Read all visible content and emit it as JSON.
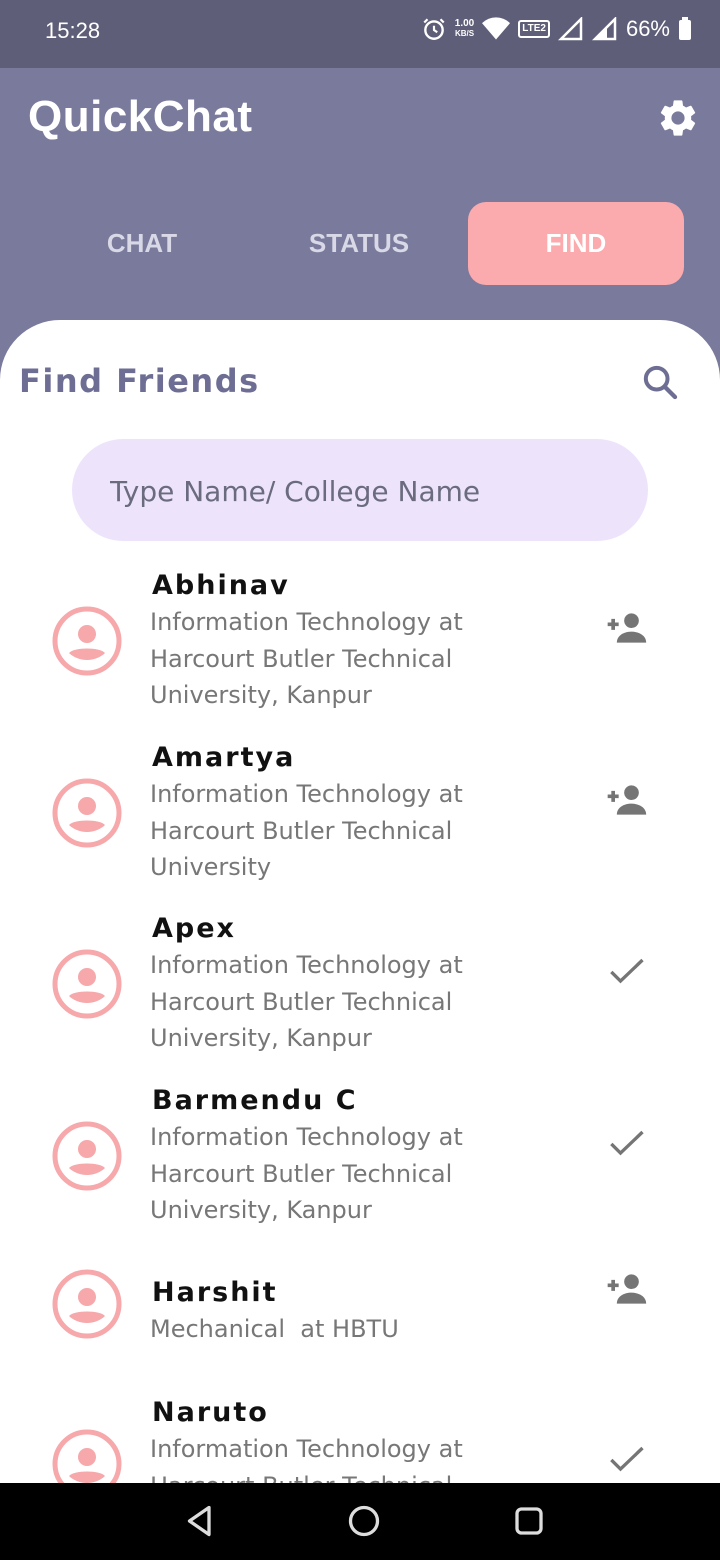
{
  "status_bar": {
    "time": "15:28",
    "net_speed_value": "1.00",
    "net_speed_unit": "KB/S",
    "lte": "LTE2",
    "battery": "66%"
  },
  "app": {
    "title": "QuickChat"
  },
  "tabs": [
    {
      "label": "CHAT",
      "active": false
    },
    {
      "label": "STATUS",
      "active": false
    },
    {
      "label": "FIND",
      "active": true
    }
  ],
  "find": {
    "title": "Find Friends",
    "search_placeholder": "Type Name/ College Name"
  },
  "friends": [
    {
      "name": "Abhinav",
      "desc_lines": [
        "Information Technology at",
        "Harcourt Butler Technical",
        "University, Kanpur"
      ],
      "action": "add-person-icon"
    },
    {
      "name": "Amartya",
      "desc_lines": [
        "Information Technology at",
        "Harcourt Butler Technical",
        "University"
      ],
      "action": "add-person-icon"
    },
    {
      "name": "Apex",
      "desc_lines": [
        "Information Technology at",
        "Harcourt Butler Technical",
        "University, Kanpur"
      ],
      "action": "check-icon"
    },
    {
      "name": "Barmendu C",
      "desc_lines": [
        "Information Technology at",
        "Harcourt Butler Technical",
        "University, Kanpur"
      ],
      "action": "check-icon"
    },
    {
      "name": "Harshit",
      "desc_lines": [
        "Mechanical  at HBTU"
      ],
      "action": "add-person-icon"
    },
    {
      "name": "Naruto",
      "desc_lines": [
        "Information Technology at",
        "Harcourt Butler Technical"
      ],
      "action": "check-icon"
    }
  ],
  "colors": {
    "header": "#7a7a9c",
    "accent": "#fbaaad",
    "search_bg": "#ede4fc",
    "title_text": "#6e6e94"
  }
}
